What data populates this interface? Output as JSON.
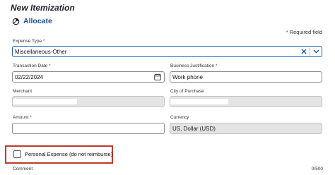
{
  "header": {
    "title": "New Itemization",
    "allocate_label": "Allocate",
    "required_note": "Required field",
    "required_marker": "*"
  },
  "form": {
    "expense_type": {
      "label": "Expense Type",
      "value": "Miscellaneous-Other"
    },
    "transaction_date": {
      "label": "Transaction Date",
      "value": "02/22/2024"
    },
    "business_justification": {
      "label": "Business Justification",
      "value": "Work phone"
    },
    "merchant": {
      "label": "Merchant",
      "value": ""
    },
    "city_of_purchase": {
      "label": "City of Purchase",
      "value": ""
    },
    "amount": {
      "label": "Amount",
      "value": ""
    },
    "currency": {
      "label": "Currency",
      "value": "US, Dollar (USD)"
    },
    "personal_expense": {
      "label": "Personal Expense (do not reimburse)",
      "checked": false
    },
    "comment": {
      "label": "Comment",
      "value": "",
      "counter": "0/500"
    }
  },
  "colors": {
    "accent": "#1a4f9c",
    "required": "#c8102e",
    "highlight_box": "#c0392b",
    "focus_border": "#1a5fc4",
    "disabled_fill": "#e4e4e4"
  },
  "icons": {
    "allocate": "allocate-icon",
    "clear": "clear-icon",
    "dropdown": "chevron-down-icon",
    "calendar": "calendar-icon"
  }
}
